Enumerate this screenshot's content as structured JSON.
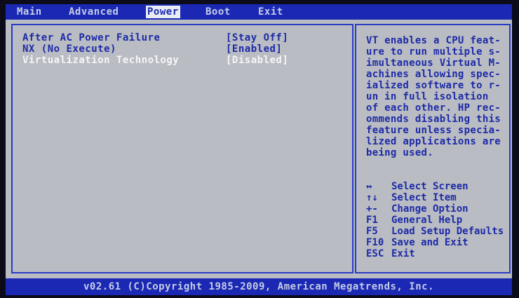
{
  "menu": {
    "items": [
      {
        "label": "Main"
      },
      {
        "label": "Advanced"
      },
      {
        "label": "Power"
      },
      {
        "label": "Boot"
      },
      {
        "label": "Exit"
      }
    ],
    "active": "Power"
  },
  "settings": [
    {
      "label": "After AC Power Failure",
      "value": "[Stay Off]"
    },
    {
      "label": "NX (No Execute)",
      "value": "[Enabled]"
    },
    {
      "label": "Virtualization Technology",
      "value": "[Disabled]",
      "selected": true
    }
  ],
  "help": {
    "lines": [
      "VT enables a CPU feat-",
      "ure to run multiple s-",
      "imultaneous Virtual M-",
      "achines allowing spec-",
      "ialized software to r-",
      "un in full isolation",
      "of each other. HP rec-",
      "ommends disabling this",
      "feature unless specia-",
      "lized applications are",
      "being used."
    ]
  },
  "keys": [
    {
      "key": "↔",
      "desc": "Select Screen"
    },
    {
      "key": "↑↓",
      "desc": "Select Item"
    },
    {
      "key": "+-",
      "desc": "Change Option"
    },
    {
      "key": "F1",
      "desc": "General Help"
    },
    {
      "key": "F5",
      "desc": "Load Setup Defaults"
    },
    {
      "key": "F10",
      "desc": "Save and Exit"
    },
    {
      "key": "ESC",
      "desc": "Exit"
    }
  ],
  "footer": {
    "text": "v02.61 (C)Copyright 1985-2009, American Megatrends, Inc."
  }
}
